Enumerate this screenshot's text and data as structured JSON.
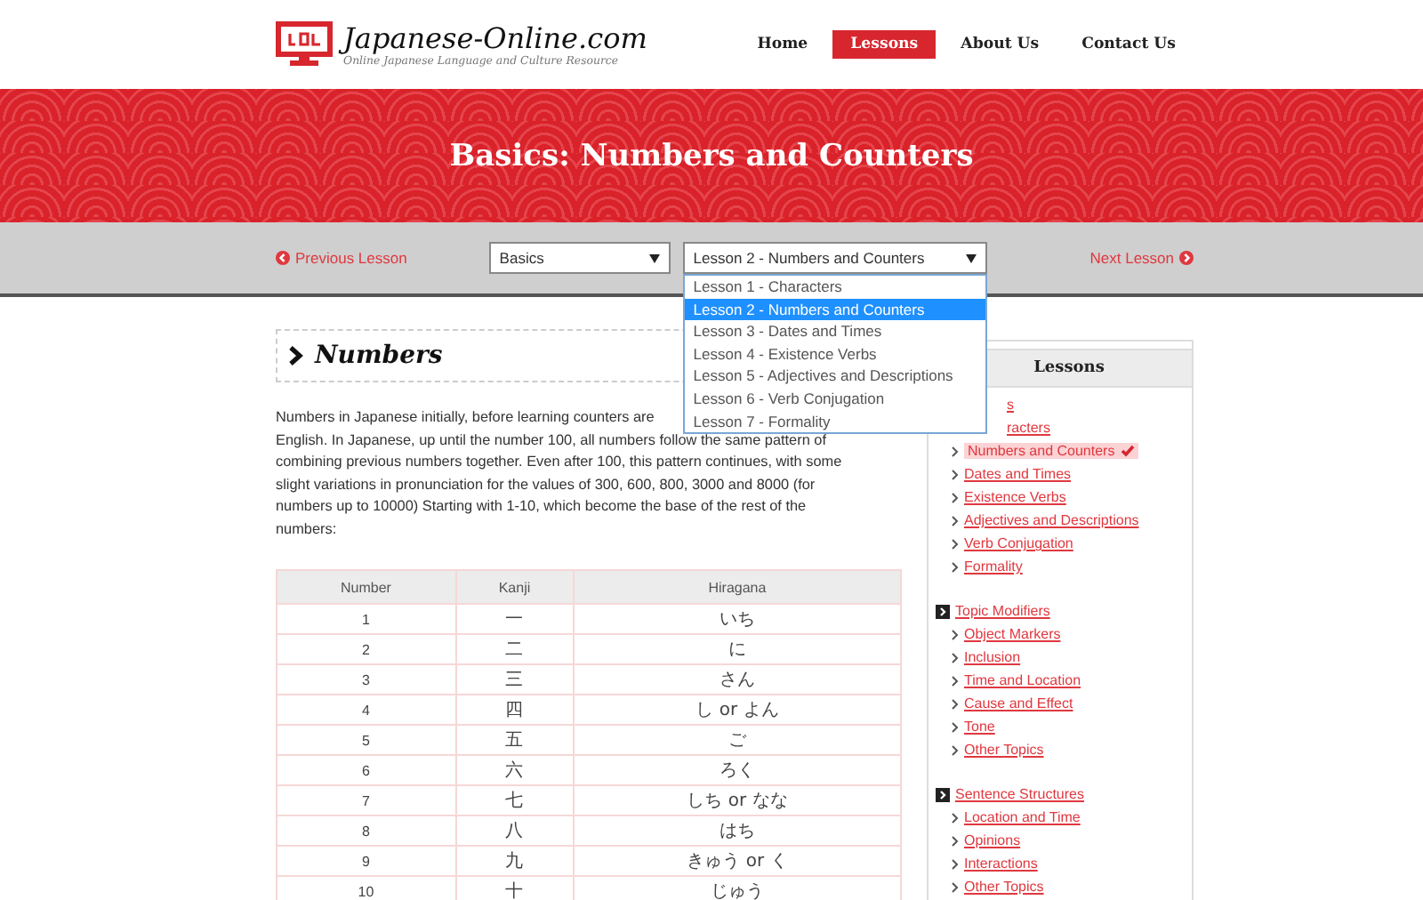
{
  "site": {
    "title": "Japanese-Online.com",
    "tagline": "Online Japanese Language and Culture Resource"
  },
  "nav": [
    {
      "label": "Home",
      "selected": false
    },
    {
      "label": "Lessons",
      "selected": true
    },
    {
      "label": "About Us",
      "selected": false
    },
    {
      "label": "Contact Us",
      "selected": false
    }
  ],
  "banner": {
    "title": "Basics: Numbers and Counters"
  },
  "lesson_bar": {
    "previous": "Previous Lesson",
    "next": "Next Lesson",
    "category_select": {
      "value": "Basics"
    },
    "lesson_select": {
      "value": "Lesson 2 - Numbers and Counters",
      "expanded": true,
      "options": [
        {
          "label": "Lesson 1 - Characters",
          "selected": false
        },
        {
          "label": "Lesson 2 - Numbers and Counters",
          "selected": true
        },
        {
          "label": "Lesson 3 - Dates and Times",
          "selected": false
        },
        {
          "label": "Lesson 4 - Existence Verbs",
          "selected": false
        },
        {
          "label": "Lesson 5 - Adjectives and Descriptions",
          "selected": false
        },
        {
          "label": "Lesson 6 - Verb Conjugation",
          "selected": false
        },
        {
          "label": "Lesson 7 - Formality",
          "selected": false
        }
      ]
    }
  },
  "article": {
    "heading": "Numbers",
    "paragraph_lines": [
      "Numbers in Japanese initially, before learning counters are",
      "English. In Japanese, up until the number 100, all numbers follow the same pattern of",
      "combining previous numbers together. Even after 100, this pattern continues, with some",
      "slight variations in pronunciation for the values of 300, 600, 800, 3000 and 8000 (for",
      "numbers up to 10000) Starting with 1-10, which become the base of the rest of the",
      "numbers:"
    ],
    "table": {
      "columns": [
        "Number",
        "Kanji",
        "Hiragana"
      ],
      "rows": [
        [
          "1",
          "一",
          "いち"
        ],
        [
          "2",
          "二",
          "に"
        ],
        [
          "3",
          "三",
          "さん"
        ],
        [
          "4",
          "四",
          "し or よん"
        ],
        [
          "5",
          "五",
          "ご"
        ],
        [
          "6",
          "六",
          "ろく"
        ],
        [
          "7",
          "七",
          "しち or なな"
        ],
        [
          "8",
          "八",
          "はち"
        ],
        [
          "9",
          "九",
          "きゅう or く"
        ],
        [
          "10",
          "十",
          "じゅう"
        ]
      ]
    }
  },
  "sidebar": {
    "title": "Lessons",
    "groups": [
      {
        "title": "s",
        "partly_covered": true,
        "items": [
          {
            "label": "racters",
            "selected": false,
            "partly_covered": true
          },
          {
            "label": "Numbers and Counters",
            "selected": true
          },
          {
            "label": "Dates and Times",
            "selected": false
          },
          {
            "label": "Existence Verbs",
            "selected": false
          },
          {
            "label": "Adjectives and Descriptions",
            "selected": false
          },
          {
            "label": "Verb Conjugation",
            "selected": false
          },
          {
            "label": "Formality",
            "selected": false
          }
        ]
      },
      {
        "title": "Topic Modifiers",
        "items": [
          {
            "label": "Object Markers",
            "selected": false
          },
          {
            "label": "Inclusion",
            "selected": false
          },
          {
            "label": "Time and Location",
            "selected": false
          },
          {
            "label": "Cause and Effect",
            "selected": false
          },
          {
            "label": "Tone",
            "selected": false
          },
          {
            "label": "Other Topics",
            "selected": false
          }
        ]
      },
      {
        "title": "Sentence Structures",
        "items": [
          {
            "label": "Location and Time",
            "selected": false
          },
          {
            "label": "Opinions",
            "selected": false
          },
          {
            "label": "Interactions",
            "selected": false
          },
          {
            "label": "Other Topics",
            "selected": false
          }
        ]
      }
    ]
  }
}
